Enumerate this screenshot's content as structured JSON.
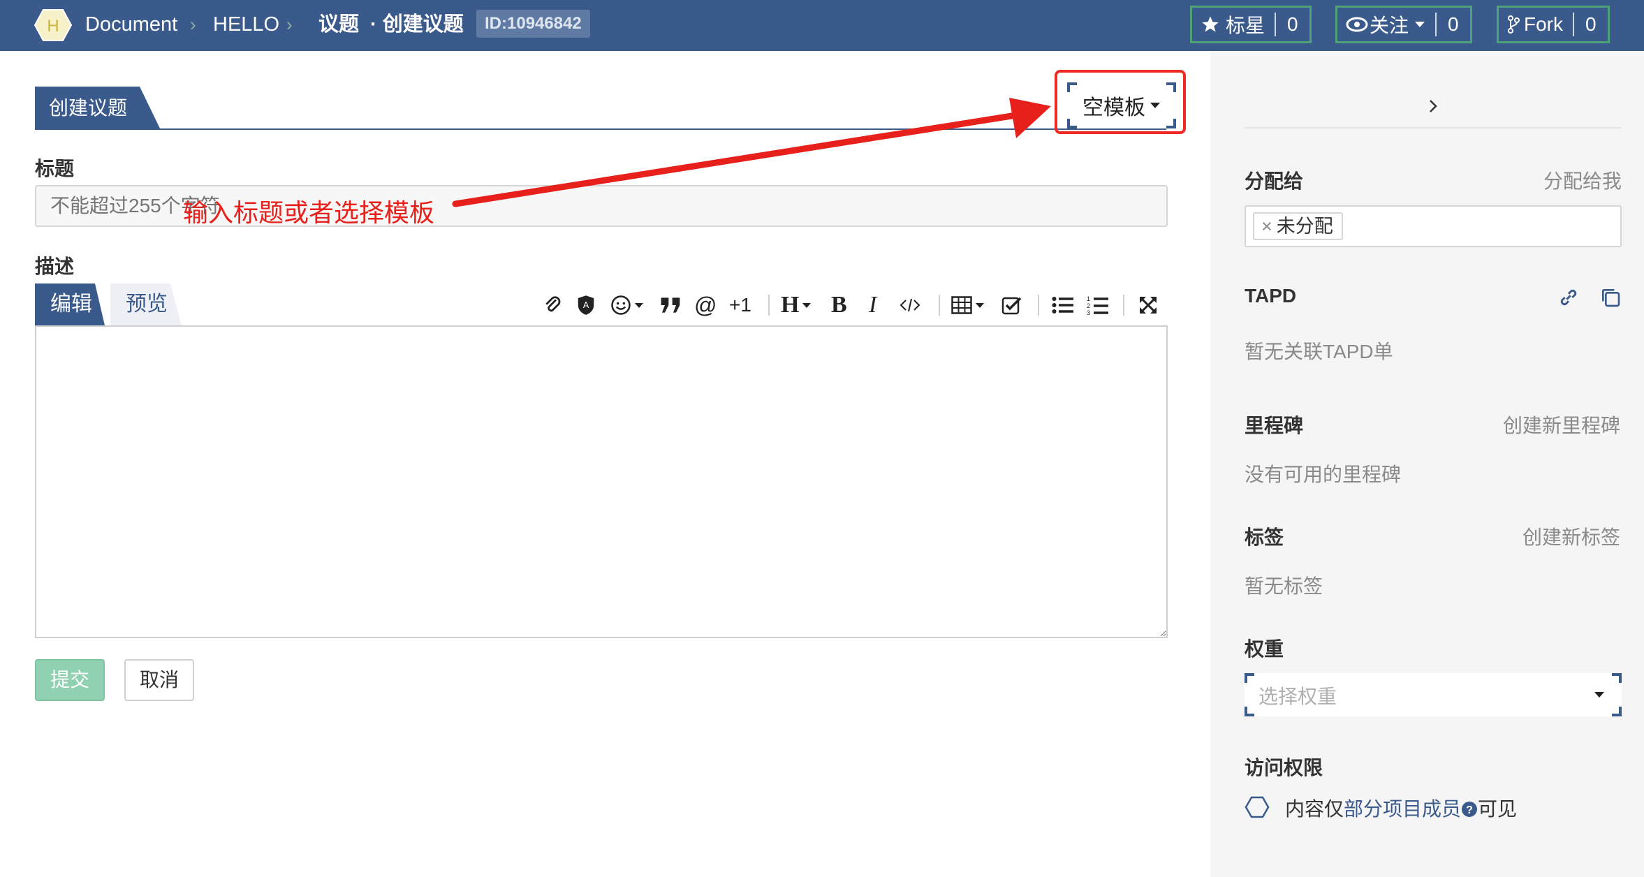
{
  "topbar": {
    "project_initial": "H",
    "breadcrumb": [
      "Document",
      "HELLO",
      "议题",
      "· 创建议题"
    ],
    "issue_id": "ID:10946842",
    "star": {
      "label": "标星",
      "count": "0"
    },
    "watch": {
      "label": "关注",
      "count": "0"
    },
    "fork": {
      "label": "Fork",
      "count": "0"
    }
  },
  "main": {
    "tab_title": "创建议题",
    "template_button": "空模板",
    "title_label": "标题",
    "title_placeholder": "不能超过255个字符",
    "annotation": "输入标题或者选择模板",
    "description_label": "描述",
    "editor_tabs": {
      "edit": "编辑",
      "preview": "预览"
    },
    "toolbar": {
      "mention": "@",
      "plus_one": "+1"
    },
    "submit": "提交",
    "cancel": "取消"
  },
  "sidebar": {
    "assign": {
      "title": "分配给",
      "action": "分配给我",
      "tag": "未分配"
    },
    "tapd": {
      "title": "TAPD",
      "empty": "暂无关联TAPD单"
    },
    "milestone": {
      "title": "里程碑",
      "action": "创建新里程碑",
      "empty": "没有可用的里程碑"
    },
    "labels": {
      "title": "标签",
      "action": "创建新标签",
      "empty": "暂无标签"
    },
    "weight": {
      "title": "权重",
      "placeholder": "选择权重"
    },
    "access": {
      "title": "访问权限",
      "prefix": "内容仅",
      "link": "部分项目成员",
      "suffix": "可见"
    }
  },
  "colors": {
    "primary": "#3b5a8c",
    "accent_green": "#4ea27a",
    "annotation_red": "#e8201b"
  }
}
